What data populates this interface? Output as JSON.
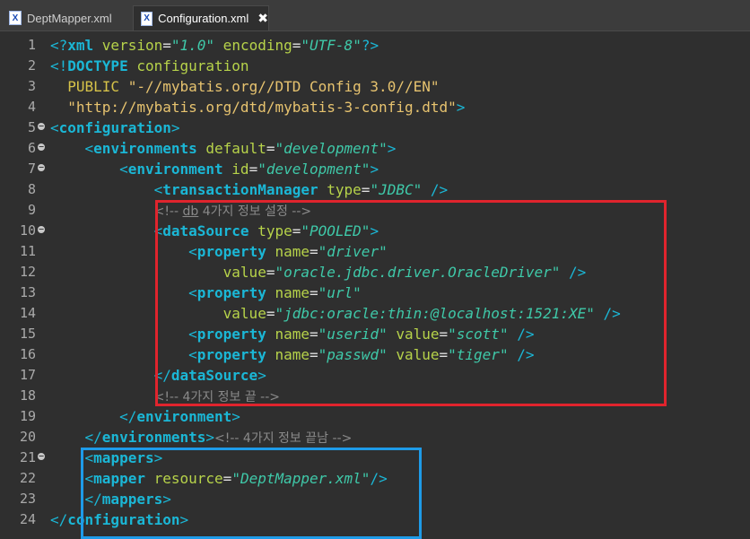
{
  "tabs": [
    {
      "label": "DeptMapper.xml",
      "active": false,
      "icon": "xml-file-icon"
    },
    {
      "label": "Configuration.xml",
      "active": true,
      "icon": "xml-file-icon"
    }
  ],
  "lines": [
    {
      "n": "1",
      "fold": false,
      "t": [
        [
          "p",
          "<?"
        ],
        [
          "t",
          "xml "
        ],
        [
          "at",
          "version"
        ],
        [
          "eq",
          "="
        ],
        [
          "v",
          "\"1.0\""
        ],
        [
          "at",
          " encoding"
        ],
        [
          "eq",
          "="
        ],
        [
          "v",
          "\"UTF-8\""
        ],
        [
          "p",
          "?>"
        ]
      ]
    },
    {
      "n": "2",
      "fold": false,
      "t": [
        [
          "p",
          "<!"
        ],
        [
          "t",
          "DOCTYPE "
        ],
        [
          "at",
          "configuration"
        ]
      ]
    },
    {
      "n": "3",
      "fold": false,
      "t": [
        [
          "ky",
          "  PUBLIC "
        ],
        [
          "st",
          "\"-//mybatis.org//DTD Config 3.0//EN\""
        ]
      ]
    },
    {
      "n": "4",
      "fold": false,
      "t": [
        [
          "st",
          "  \"http://mybatis.org/dtd/mybatis-3-config.dtd\""
        ],
        [
          "p",
          ">"
        ]
      ]
    },
    {
      "n": "5",
      "fold": true,
      "t": [
        [
          "p",
          "<"
        ],
        [
          "t",
          "configuration"
        ],
        [
          "p",
          ">"
        ]
      ]
    },
    {
      "n": "6",
      "fold": true,
      "t": [
        [
          "p",
          "    <"
        ],
        [
          "t",
          "environments "
        ],
        [
          "at",
          "default"
        ],
        [
          "eq",
          "="
        ],
        [
          "v",
          "\"development\""
        ],
        [
          "p",
          ">"
        ]
      ]
    },
    {
      "n": "7",
      "fold": true,
      "t": [
        [
          "p",
          "        <"
        ],
        [
          "t",
          "environment "
        ],
        [
          "at",
          "id"
        ],
        [
          "eq",
          "="
        ],
        [
          "v",
          "\"development\""
        ],
        [
          "p",
          ">"
        ]
      ]
    },
    {
      "n": "8",
      "fold": false,
      "t": [
        [
          "p",
          "            <"
        ],
        [
          "t",
          "transactionManager "
        ],
        [
          "at",
          "type"
        ],
        [
          "eq",
          "="
        ],
        [
          "v",
          "\"JDBC\""
        ],
        [
          "p",
          " />"
        ]
      ]
    },
    {
      "n": "9",
      "fold": false,
      "t": [
        [
          "p",
          "            "
        ],
        [
          "cm",
          "<!-- "
        ],
        [
          "cmu",
          "db"
        ],
        [
          "cm",
          " 4가지 정보 설정 -->"
        ]
      ]
    },
    {
      "n": "10",
      "fold": true,
      "t": [
        [
          "p",
          "            <"
        ],
        [
          "t",
          "dataSource "
        ],
        [
          "at",
          "type"
        ],
        [
          "eq",
          "="
        ],
        [
          "v",
          "\"POOLED\""
        ],
        [
          "p",
          ">"
        ]
      ]
    },
    {
      "n": "11",
      "fold": false,
      "t": [
        [
          "p",
          "                <"
        ],
        [
          "t",
          "property "
        ],
        [
          "at",
          "name"
        ],
        [
          "eq",
          "="
        ],
        [
          "v",
          "\"driver\""
        ]
      ]
    },
    {
      "n": "12",
      "fold": false,
      "t": [
        [
          "at",
          "                    value"
        ],
        [
          "eq",
          "="
        ],
        [
          "v",
          "\"oracle.jdbc.driver.OracleDriver\""
        ],
        [
          "p",
          " />"
        ]
      ]
    },
    {
      "n": "13",
      "fold": false,
      "t": [
        [
          "p",
          "                <"
        ],
        [
          "t",
          "property "
        ],
        [
          "at",
          "name"
        ],
        [
          "eq",
          "="
        ],
        [
          "v",
          "\"url\""
        ]
      ]
    },
    {
      "n": "14",
      "fold": false,
      "t": [
        [
          "at",
          "                    value"
        ],
        [
          "eq",
          "="
        ],
        [
          "v",
          "\"jdbc:oracle:thin:@localhost:1521:XE\""
        ],
        [
          "p",
          " />"
        ]
      ]
    },
    {
      "n": "15",
      "fold": false,
      "t": [
        [
          "p",
          "                <"
        ],
        [
          "t",
          "property "
        ],
        [
          "at",
          "name"
        ],
        [
          "eq",
          "="
        ],
        [
          "v",
          "\"userid\""
        ],
        [
          "at",
          " value"
        ],
        [
          "eq",
          "="
        ],
        [
          "v",
          "\"scott\""
        ],
        [
          "p",
          " />"
        ]
      ]
    },
    {
      "n": "16",
      "fold": false,
      "t": [
        [
          "p",
          "                <"
        ],
        [
          "t",
          "property "
        ],
        [
          "at",
          "name"
        ],
        [
          "eq",
          "="
        ],
        [
          "v",
          "\"passwd\""
        ],
        [
          "at",
          " value"
        ],
        [
          "eq",
          "="
        ],
        [
          "v",
          "\"tiger\""
        ],
        [
          "p",
          " />"
        ]
      ]
    },
    {
      "n": "17",
      "fold": false,
      "t": [
        [
          "p",
          "            </"
        ],
        [
          "t",
          "dataSource"
        ],
        [
          "p",
          ">"
        ]
      ]
    },
    {
      "n": "18",
      "fold": false,
      "t": [
        [
          "p",
          "            "
        ],
        [
          "cm",
          "<!-- 4가지 정보 끝 -->"
        ]
      ]
    },
    {
      "n": "19",
      "fold": false,
      "t": [
        [
          "p",
          "        </"
        ],
        [
          "t",
          "environment"
        ],
        [
          "p",
          ">"
        ]
      ]
    },
    {
      "n": "20",
      "fold": false,
      "t": [
        [
          "p",
          "    </"
        ],
        [
          "t",
          "environments"
        ],
        [
          "p",
          ">"
        ],
        [
          "cm",
          "<!-- 4가지 정보 끝남 -->"
        ]
      ]
    },
    {
      "n": "21",
      "fold": true,
      "t": [
        [
          "p",
          "    <"
        ],
        [
          "t",
          "mappers"
        ],
        [
          "p",
          ">"
        ]
      ]
    },
    {
      "n": "22",
      "fold": false,
      "t": [
        [
          "p",
          "    <"
        ],
        [
          "t",
          "mapper "
        ],
        [
          "at",
          "resource"
        ],
        [
          "eq",
          "="
        ],
        [
          "v",
          "\"DeptMapper.xml\""
        ],
        [
          "p",
          "/>"
        ]
      ]
    },
    {
      "n": "23",
      "fold": false,
      "t": [
        [
          "p",
          "    </"
        ],
        [
          "t",
          "mappers"
        ],
        [
          "p",
          ">"
        ]
      ]
    },
    {
      "n": "24",
      "fold": false,
      "t": [
        [
          "p",
          "</"
        ],
        [
          "t",
          "configuration"
        ],
        [
          "p",
          ">"
        ]
      ]
    }
  ],
  "colors": {
    "highlight_red": "#e0242d",
    "highlight_blue": "#1e9be8"
  }
}
